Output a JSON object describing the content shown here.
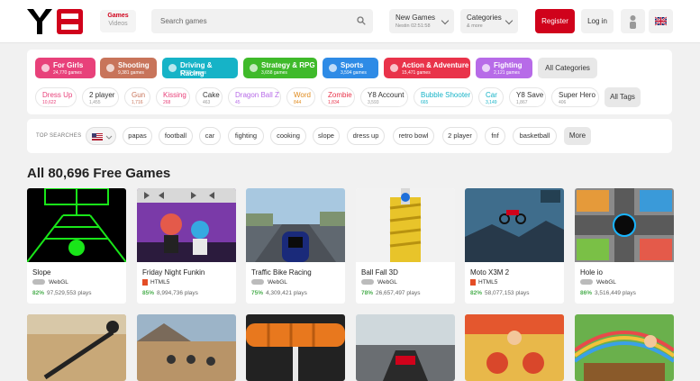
{
  "header": {
    "logo": "Y8",
    "games_tab": "Games",
    "videos_tab": "Videos",
    "search_placeholder": "Search games",
    "new_games": {
      "label": "New Games",
      "sub": "Nestin 02:51:58"
    },
    "categories": {
      "label": "Categories",
      "sub": "& more"
    },
    "register": "Register",
    "login": "Log in",
    "user_icon": "user-icon",
    "language_icon": "uk-flag-icon"
  },
  "categories": [
    {
      "label": "For Girls",
      "count": "24,770 games",
      "color": "#e8417a",
      "icon": "dress-icon"
    },
    {
      "label": "Shooting",
      "count": "9,381 games",
      "color": "#c8745a",
      "icon": "crosshair-icon"
    },
    {
      "label": "Driving & Racing",
      "count": "6,729 games",
      "color": "#16b3c7",
      "icon": "car-icon"
    },
    {
      "label": "Strategy & RPG",
      "count": "3,658 games",
      "color": "#3fba2a",
      "icon": "arrow-icon"
    },
    {
      "label": "Sports",
      "count": "3,594 games",
      "color": "#2e8be6",
      "icon": "ball-icon"
    },
    {
      "label": "Action & Adventure",
      "count": "15,471 games",
      "color": "#e9334a",
      "icon": "gamepad-icon"
    },
    {
      "label": "Fighting",
      "count": "2,121 games",
      "color": "#b76be8",
      "icon": "swords-icon"
    }
  ],
  "all_categories": "All Categories",
  "tags": [
    {
      "label": "Dress Up",
      "count": "10,622",
      "color": "#e8417a"
    },
    {
      "label": "2 player",
      "count": "1,455",
      "color": "#333333"
    },
    {
      "label": "Gun",
      "count": "1,716",
      "color": "#c8745a"
    },
    {
      "label": "Kissing",
      "count": "268",
      "color": "#e8417a"
    },
    {
      "label": "Cake",
      "count": "463",
      "color": "#333333"
    },
    {
      "label": "Dragon Ball Z",
      "count": "45",
      "color": "#b76be8"
    },
    {
      "label": "Word",
      "count": "844",
      "color": "#e08a1c"
    },
    {
      "label": "Zombie",
      "count": "1,834",
      "color": "#e9334a"
    },
    {
      "label": "Y8 Account",
      "count": "3,593",
      "color": "#333333"
    },
    {
      "label": "Bubble Shooter",
      "count": "665",
      "color": "#16b3c7"
    },
    {
      "label": "Car",
      "count": "3,149",
      "color": "#16b3c7"
    },
    {
      "label": "Y8 Save",
      "count": "1,867",
      "color": "#333333"
    },
    {
      "label": "Super Hero",
      "count": "406",
      "color": "#333333"
    }
  ],
  "all_tags": "All Tags",
  "top_searches_label": "TOP SEARCHES",
  "top_searches": [
    "papas",
    "football",
    "car",
    "fighting",
    "cooking",
    "slope",
    "dress up",
    "retro bowl",
    "2 player",
    "fnf",
    "basketball"
  ],
  "more": "More",
  "section_title": "All 80,696 Free Games",
  "games": [
    {
      "name": "Slope",
      "tech": "WebGL",
      "rating": "82%",
      "plays": "97,529,553 plays"
    },
    {
      "name": "Friday Night Funkin",
      "tech": "HTML5",
      "rating": "85%",
      "plays": "8,994,736 plays"
    },
    {
      "name": "Traffic Bike Racing",
      "tech": "WebGL",
      "rating": "75%",
      "plays": "4,309,421 plays"
    },
    {
      "name": "Ball Fall 3D",
      "tech": "WebGL",
      "rating": "78%",
      "plays": "26,657,497 plays"
    },
    {
      "name": "Moto X3M 2",
      "tech": "HTML5",
      "rating": "82%",
      "plays": "58,077,153 plays"
    },
    {
      "name": "Hole io",
      "tech": "WebGL",
      "rating": "86%",
      "plays": "3,516,449 plays"
    }
  ],
  "colors": {
    "brand": "#d0021b",
    "rating": "#4caf50"
  }
}
